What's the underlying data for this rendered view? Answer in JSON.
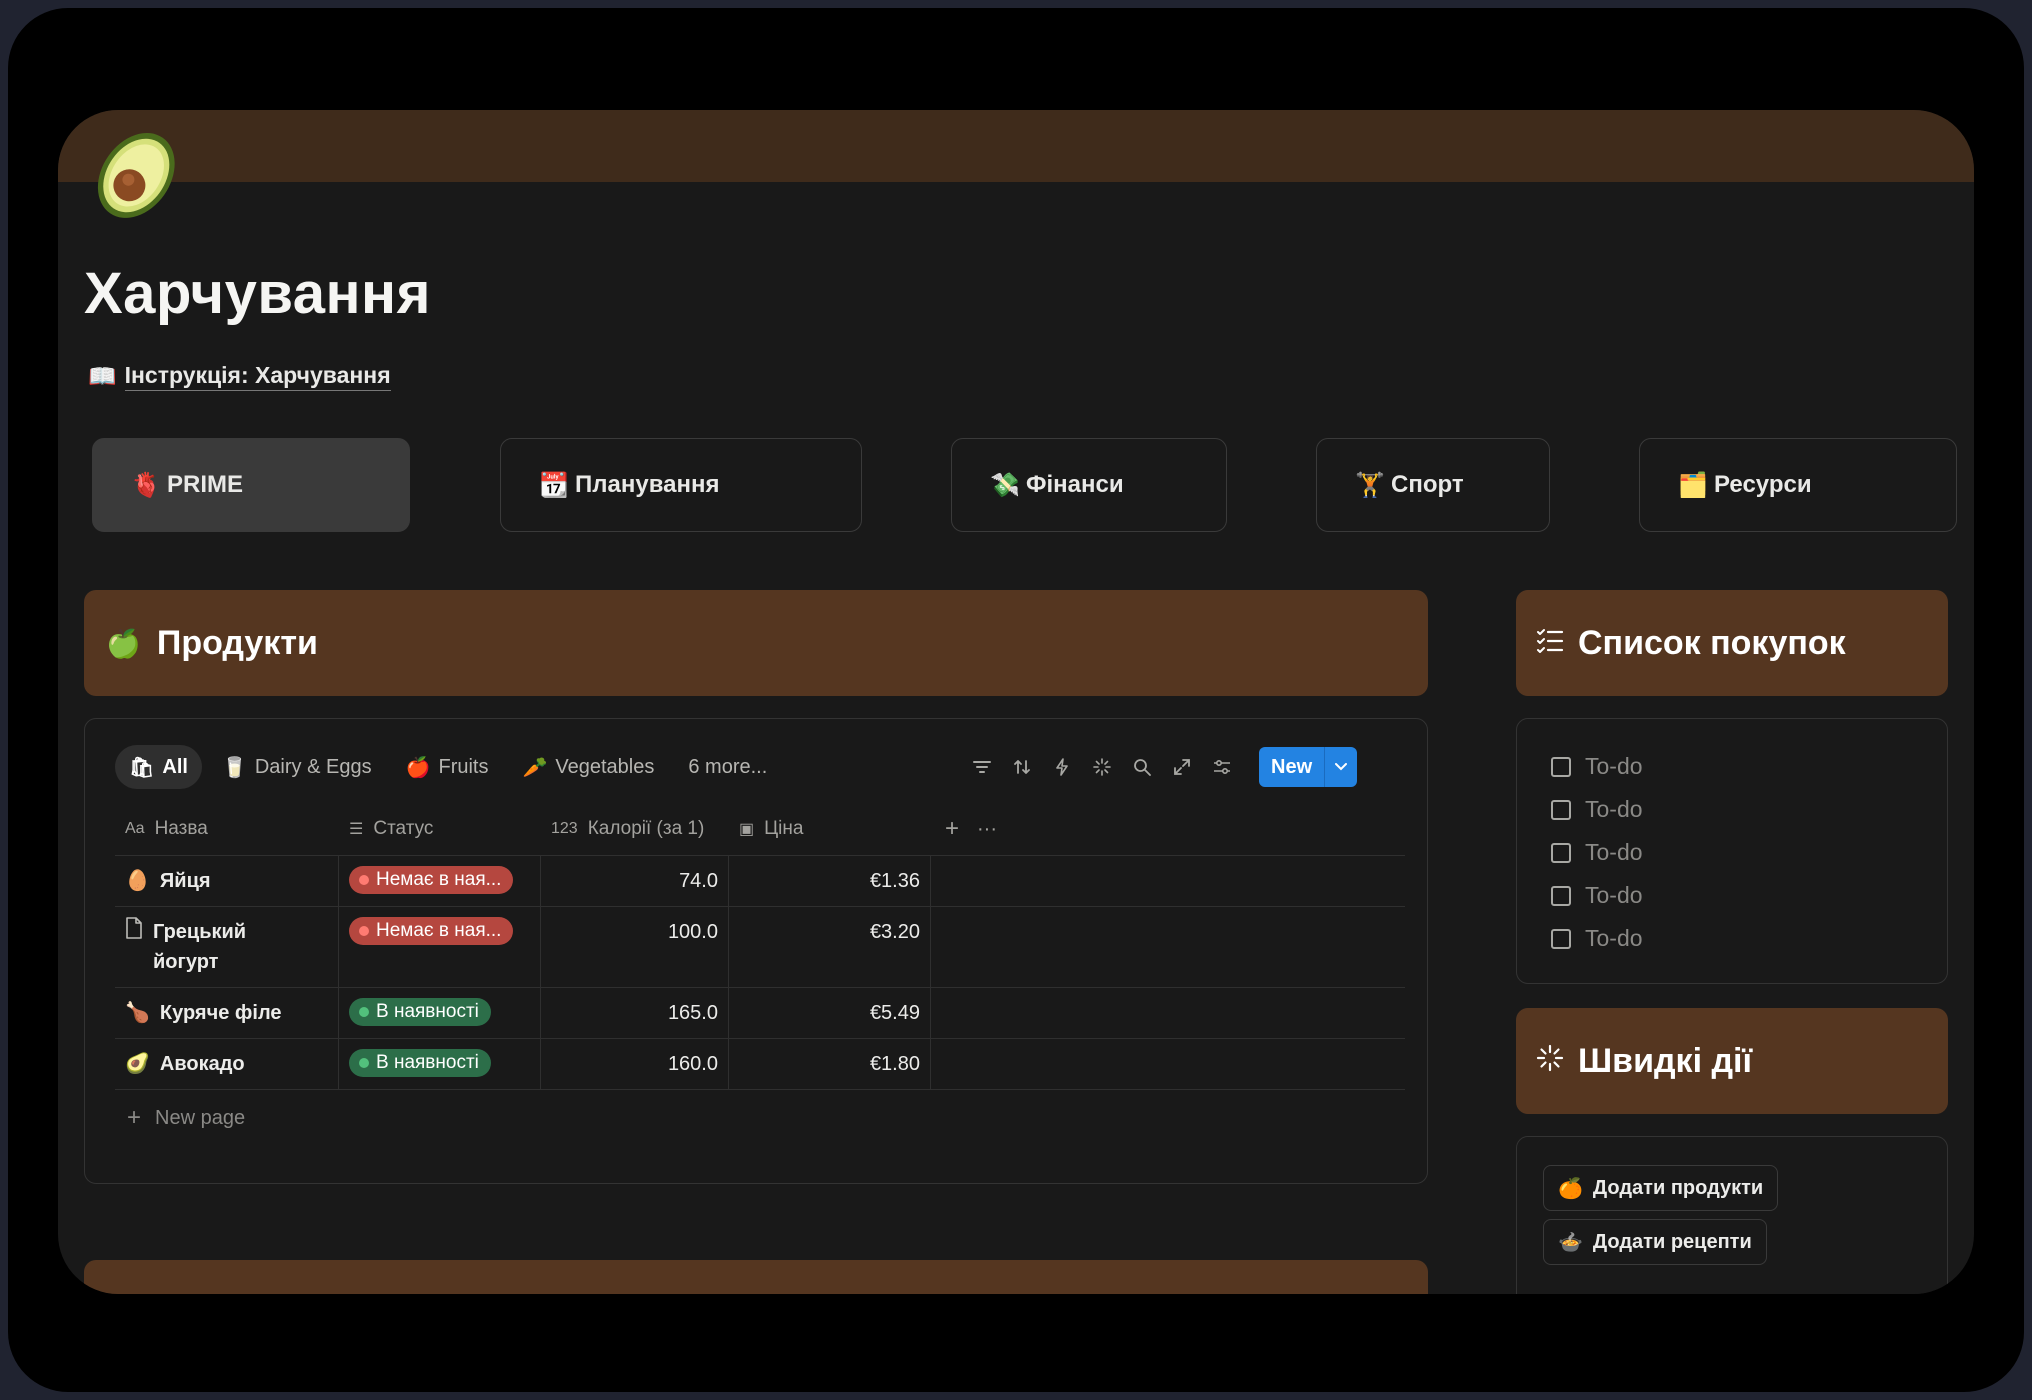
{
  "page": {
    "title": "Харчування",
    "icon": "avocado-icon",
    "cover_color": "#3f2b1b",
    "instruction_link": {
      "emoji": "📖",
      "label": "Інструкція: Харчування"
    }
  },
  "nav": [
    {
      "emoji": "🫀",
      "label": "PRIME",
      "active": true
    },
    {
      "emoji": "📆",
      "label": "Планування"
    },
    {
      "emoji": "💸",
      "label": "Фінанси"
    },
    {
      "emoji": "🏋️",
      "label": "Спорт"
    },
    {
      "emoji": "🗂️",
      "label": "Ресурси"
    }
  ],
  "products": {
    "header": {
      "emoji": "🍏",
      "title": "Продукти"
    },
    "tabs": [
      {
        "icon": "all-icon",
        "label": "All",
        "active": true
      },
      {
        "icon": "milk-icon",
        "label": "Dairy & Eggs"
      },
      {
        "icon": "apple-icon",
        "label": "Fruits"
      },
      {
        "icon": "carrot-icon",
        "label": "Vegetables"
      },
      {
        "icon": "",
        "label": "6 more..."
      }
    ],
    "toolbar": {
      "tools": [
        "filter-icon",
        "sort-icon",
        "automation-icon",
        "ai-sparkle-icon",
        "search-icon",
        "expand-icon",
        "settings-icon"
      ],
      "new_label": "New"
    },
    "columns": [
      {
        "icon": "Aa",
        "label": "Назва"
      },
      {
        "icon": "☰",
        "label": "Статус"
      },
      {
        "icon": "123",
        "label": "Калорії (за 1)"
      },
      {
        "icon": "▣",
        "label": "Ціна"
      }
    ],
    "rows": [
      {
        "emoji": "🥚",
        "name": "Яйця",
        "status": "Немає в ная...",
        "status_color": "red",
        "calories": "74.0",
        "price": "€1.36"
      },
      {
        "emoji": "📄",
        "name": "Грецький йогурт",
        "status": "Немає в ная...",
        "status_color": "red",
        "calories": "100.0",
        "price": "€3.20"
      },
      {
        "emoji": "🍗",
        "name": "Куряче філе",
        "status": "В наявності",
        "status_color": "green",
        "calories": "165.0",
        "price": "€5.49"
      },
      {
        "emoji": "🥑",
        "name": "Авокадо",
        "status": "В наявності",
        "status_color": "green",
        "calories": "160.0",
        "price": "€1.80"
      }
    ],
    "new_page_label": "New page"
  },
  "shopping_list": {
    "header": {
      "emoji": "☑️",
      "title": "Список покупок"
    },
    "items": [
      "To-do",
      "To-do",
      "To-do",
      "To-do",
      "To-do"
    ]
  },
  "quick_actions": {
    "header": {
      "emoji": "✳️",
      "title": "Швидкі дії"
    },
    "buttons": [
      {
        "emoji": "🍊",
        "label": "Додати продукти"
      },
      {
        "emoji": "🍲",
        "label": "Додати рецепти"
      }
    ]
  },
  "colors": {
    "section_header": "#553620",
    "accent_blue": "#2383e2",
    "status_red": "#b5473f",
    "status_green": "#2c6e49"
  }
}
